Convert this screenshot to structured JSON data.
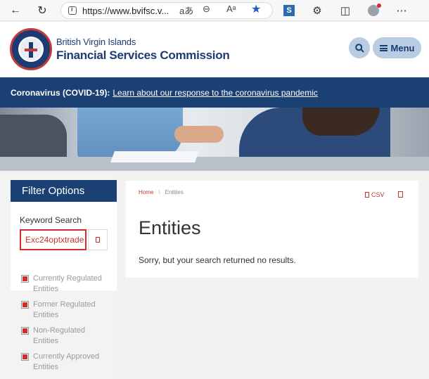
{
  "browser": {
    "url": "https://www.bvifsc.v...",
    "read_aloud_label": "aあ",
    "zoom_icon": "zoom-out-icon",
    "reader_label": "Aᵃ"
  },
  "header": {
    "brand_line1": "British Virgin Islands",
    "brand_line2": "Financial Services Commission",
    "menu_label": "Menu"
  },
  "covid": {
    "lead": "Coronavirus (COVID-19):",
    "link": "Learn about our response to the coronavirus pandemic"
  },
  "sidebar": {
    "title": "Filter Options",
    "keyword_label": "Keyword Search",
    "keyword_value": "Exc24optxtrade",
    "filters": [
      {
        "label": "Currently Regulated Entities"
      },
      {
        "label": "Former Regulated Entities"
      },
      {
        "label": "Non-Regulated Entities"
      },
      {
        "label": "Currently Approved Entities"
      }
    ]
  },
  "main": {
    "breadcrumb_home": "Home",
    "breadcrumb_sep": "\\",
    "breadcrumb_current": "Entities",
    "csv_label": "CSV",
    "title": "Entities",
    "message": "Sorry, but your search returned no results."
  },
  "colors": {
    "brand_navy": "#1b4073",
    "accent_red": "#d42b2b",
    "header_button": "#b8cde4"
  }
}
